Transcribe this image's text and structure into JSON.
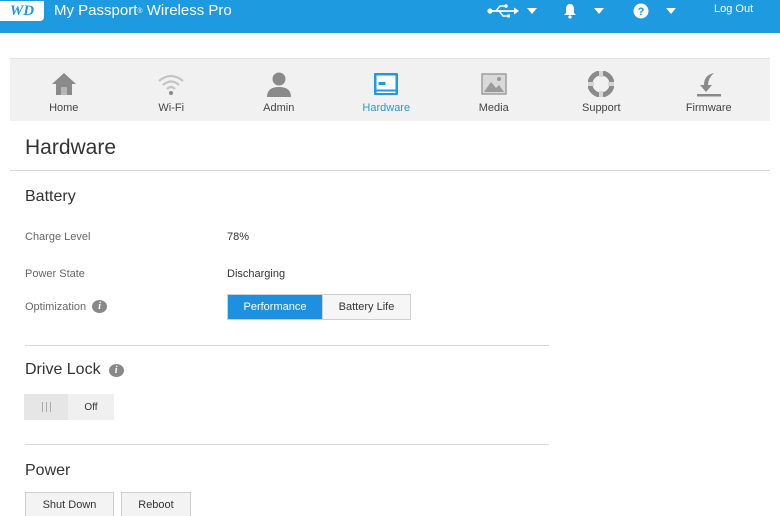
{
  "header": {
    "logo_text": "WD",
    "app_name": "My Passport",
    "app_suffix": "Wireless Pro",
    "logout_label": "Log Out",
    "icons": [
      "usb-icon",
      "bell-icon",
      "help-icon"
    ]
  },
  "colors": {
    "topbar": "#1e9ae0",
    "accent": "#1e90e0",
    "nav_bg": "#f1f1f1"
  },
  "nav": {
    "items": [
      {
        "label": "Home",
        "icon": "home-icon"
      },
      {
        "label": "Wi-Fi",
        "icon": "wifi-icon"
      },
      {
        "label": "Admin",
        "icon": "user-icon"
      },
      {
        "label": "Hardware",
        "icon": "hardware-icon",
        "active": true
      },
      {
        "label": "Media",
        "icon": "image-icon"
      },
      {
        "label": "Support",
        "icon": "lifebuoy-icon"
      },
      {
        "label": "Firmware",
        "icon": "firmware-icon"
      }
    ]
  },
  "page": {
    "title": "Hardware"
  },
  "battery": {
    "title": "Battery",
    "charge_label": "Charge Level",
    "charge_value": "78%",
    "power_label": "Power State",
    "power_value": "Discharging",
    "optimization_label": "Optimization",
    "options": [
      "Performance",
      "Battery Life"
    ],
    "selected": "Performance"
  },
  "drive_lock": {
    "title": "Drive Lock",
    "state": "Off"
  },
  "power": {
    "title": "Power",
    "shutdown_label": "Shut Down",
    "reboot_label": "Reboot"
  }
}
